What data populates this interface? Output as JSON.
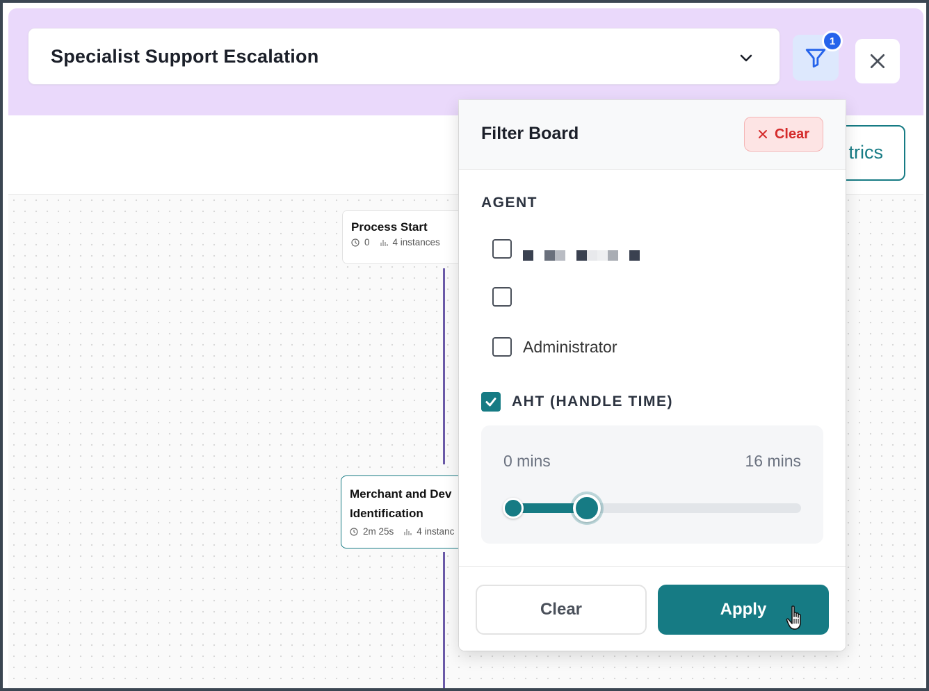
{
  "header": {
    "process_title": "Specialist Support Escalation",
    "filter_badge_count": "1"
  },
  "toolbar": {
    "metrics_button_label_visible": "trics"
  },
  "canvas": {
    "nodes": [
      {
        "name": "Process Start",
        "duration": "0",
        "instances": "4 instances"
      },
      {
        "name": "Merchant and Dev",
        "name_line2": "Identification",
        "duration": "2m 25s",
        "instances": "4 instanc"
      }
    ]
  },
  "filter_panel": {
    "title": "Filter Board",
    "header_clear_label": "Clear",
    "agent_section_label": "AGENT",
    "agents": [
      {
        "label": "",
        "checked": false,
        "redacted": true
      },
      {
        "label": "",
        "checked": false,
        "redacted": true
      },
      {
        "label": "Administrator",
        "checked": false
      }
    ],
    "aht": {
      "label": "AHT (HANDLE TIME)",
      "checked": true,
      "min_label": "0 mins",
      "max_label": "16 mins",
      "range_min_value": 0,
      "range_max_value": 16,
      "selected_low_fraction": 0,
      "selected_high_fraction": 0.255
    },
    "footer": {
      "clear_label": "Clear",
      "apply_label": "Apply"
    }
  },
  "colors": {
    "accent": "#167b84",
    "header_bg": "#ead9fb",
    "filter_button_bg": "#dde8fd",
    "badge": "#2563eb",
    "danger": "#d42a2a"
  },
  "icons": {
    "dropdown": "chevron-down-icon",
    "filter": "filter-funnel-icon",
    "close": "close-icon",
    "clock": "clock-icon",
    "instances": "bar-chart-icon",
    "clear": "x-icon",
    "cursor": "hand-pointer-icon"
  }
}
